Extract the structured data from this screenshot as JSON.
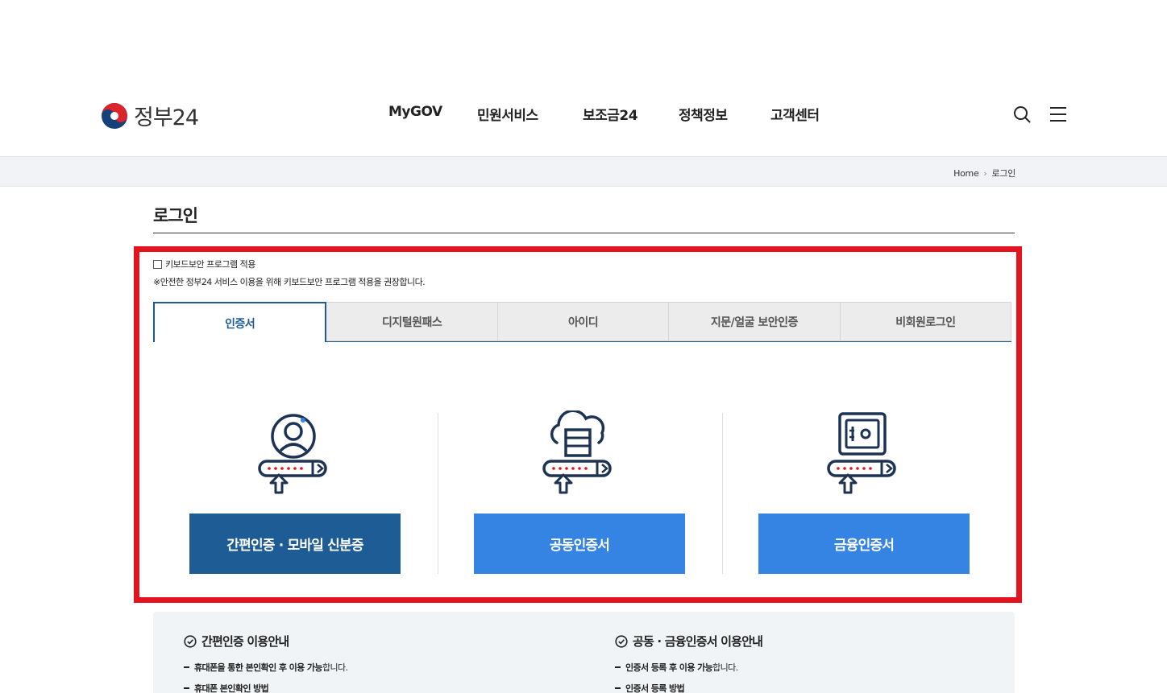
{
  "header": {
    "logo_text": "정부24",
    "nav": [
      "MyGOV",
      "민원서비스",
      "보조금24",
      "정책정보",
      "고객센터"
    ],
    "search_icon": "search-icon",
    "menu_icon": "hamburger-menu-icon"
  },
  "breadcrumb": {
    "home": "Home",
    "current": "로그인"
  },
  "page": {
    "title": "로그인"
  },
  "keyboard_security": {
    "label": "키보드보안 프로그램 적용",
    "checked": false,
    "note": "※안전한 정부24 서비스 이용을 위해 키보드보안 프로그램 적용을 권장합니다."
  },
  "tabs": [
    {
      "label": "인증서",
      "active": true
    },
    {
      "label": "디지털원패스",
      "active": false
    },
    {
      "label": "아이디",
      "active": false
    },
    {
      "label": "지문/얼굴 보안인증",
      "active": false
    },
    {
      "label": "비회원로그인",
      "active": false
    }
  ],
  "login_options": [
    {
      "label": "간편인증 · 모바일 신분증",
      "icon": "user-certificate-icon",
      "color": "#1d5c94"
    },
    {
      "label": "공동인증서",
      "icon": "cloud-server-certificate-icon",
      "color": "#3584e4"
    },
    {
      "label": "금융인증서",
      "icon": "safe-certificate-icon",
      "color": "#3584e4"
    }
  ],
  "info": {
    "left": {
      "title": "간편인증 이용안내",
      "item1_bold": "휴대폰을 통한 본인확인 후 이용 가능",
      "item1_rest": "합니다.",
      "item2": "휴대폰 본인확인 방법"
    },
    "right": {
      "title": "공동 · 금융인증서 이용안내",
      "item1_bold": "인증서 등록 후 이용 가능",
      "item1_rest": "합니다.",
      "item2": "인증서 등록 방법"
    }
  },
  "colors": {
    "primary_dark": "#1d5c94",
    "primary_light": "#3584e4",
    "highlight": "#e3141f"
  }
}
